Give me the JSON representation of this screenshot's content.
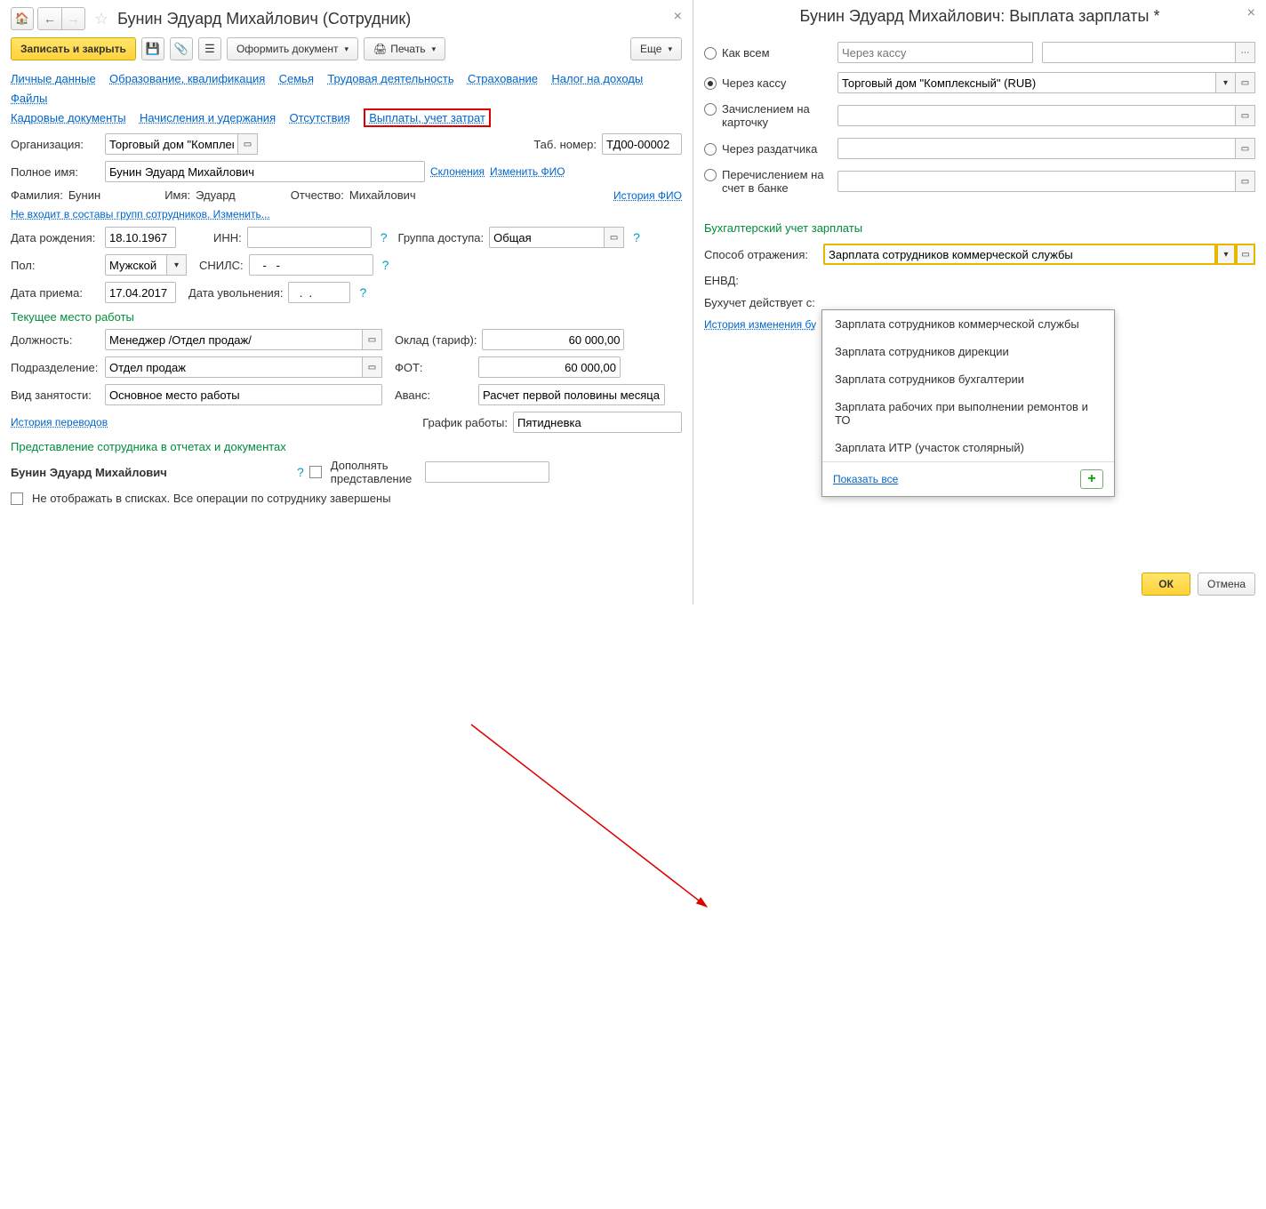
{
  "left": {
    "title": "Бунин Эдуард Михайлович (Сотрудник)",
    "toolbar": {
      "save_close": "Записать и закрыть",
      "create_doc": "Оформить документ",
      "print": "Печать",
      "more": "Еще"
    },
    "nav": {
      "personal": "Личные данные",
      "education": "Образование, квалификация",
      "family": "Семья",
      "career": "Трудовая деятельность",
      "insurance": "Страхование",
      "income_tax": "Налог на доходы",
      "files": "Файлы",
      "hr_docs": "Кадровые документы",
      "accruals": "Начисления и удержания",
      "absences": "Отсутствия",
      "payments": "Выплаты, учет затрат"
    },
    "org_lbl": "Организация:",
    "org_val": "Торговый дом \"Комплексн",
    "tabno_lbl": "Таб. номер:",
    "tabno_val": "ТД00-00002",
    "fullname_lbl": "Полное имя:",
    "fullname_val": "Бунин Эдуард Михайлович",
    "declensions": "Склонения",
    "change_fio": "Изменить ФИО",
    "surname_lbl": "Фамилия:",
    "surname_val": "Бунин",
    "name_lbl": "Имя:",
    "name_val": "Эдуард",
    "patr_lbl": "Отчество:",
    "patr_val": "Михайлович",
    "history_fio": "История ФИО",
    "not_in_groups": "Не входит в составы групп сотрудников. Изменить...",
    "dob_lbl": "Дата рождения:",
    "dob_val": "18.10.1967",
    "inn_lbl": "ИНН:",
    "inn_val": "",
    "group_lbl": "Группа доступа:",
    "group_val": "Общая",
    "sex_lbl": "Пол:",
    "sex_val": "Мужской",
    "snils_lbl": "СНИЛС:",
    "snils_val": "   -   -",
    "hire_lbl": "Дата приема:",
    "hire_val": "17.04.2017",
    "fire_lbl": "Дата увольнения:",
    "fire_val": "  .  .",
    "workplace_hdr": "Текущее место работы",
    "position_lbl": "Должность:",
    "position_val": "Менеджер /Отдел продаж/",
    "salary_lbl": "Оклад (тариф):",
    "salary_val": "60 000,00",
    "dept_lbl": "Подразделение:",
    "dept_val": "Отдел продаж",
    "fot_lbl": "ФОТ:",
    "fot_val": "60 000,00",
    "emp_type_lbl": "Вид занятости:",
    "emp_type_val": "Основное место работы",
    "advance_lbl": "Аванс:",
    "advance_val": "Расчет первой половины месяца",
    "transfer_history": "История переводов",
    "schedule_lbl": "График работы:",
    "schedule_val": "Пятидневка",
    "repr_hdr": "Представление сотрудника в отчетах и документах",
    "repr_val": "Бунин Эдуард Михайлович",
    "append_repr": "Дополнять представление",
    "hide_in_lists": "Не отображать в списках. Все операции по сотруднику завершены"
  },
  "right": {
    "title": "Бунин Эдуард Михайлович: Выплата зарплаты *",
    "radios": {
      "all": "Как всем",
      "all_ph": "Через кассу",
      "cash": "Через кассу",
      "cash_val": "Торговый дом \"Комплексный\" (RUB)",
      "card": "Зачислением на карточку",
      "distr": "Через раздатчика",
      "bank": "Перечислением на счет в банке"
    },
    "section": "Бухгалтерский учет зарплаты",
    "reflection_lbl": "Способ отражения:",
    "reflection_val": "Зарплата сотрудников коммерческой службы",
    "envd_lbl": "ЕНВД:",
    "valid_from_lbl": "Бухучет действует с:",
    "history": "История изменения бу",
    "dd": [
      "Зарплата сотрудников коммерческой службы",
      "Зарплата сотрудников дирекции",
      "Зарплата сотрудников бухгалтерии",
      "Зарплата рабочих при выполнении ремонтов и ТО",
      "Зарплата ИТР (участок столярный)"
    ],
    "show_all": "Показать все",
    "ok": "ОК",
    "cancel": "Отмена"
  }
}
